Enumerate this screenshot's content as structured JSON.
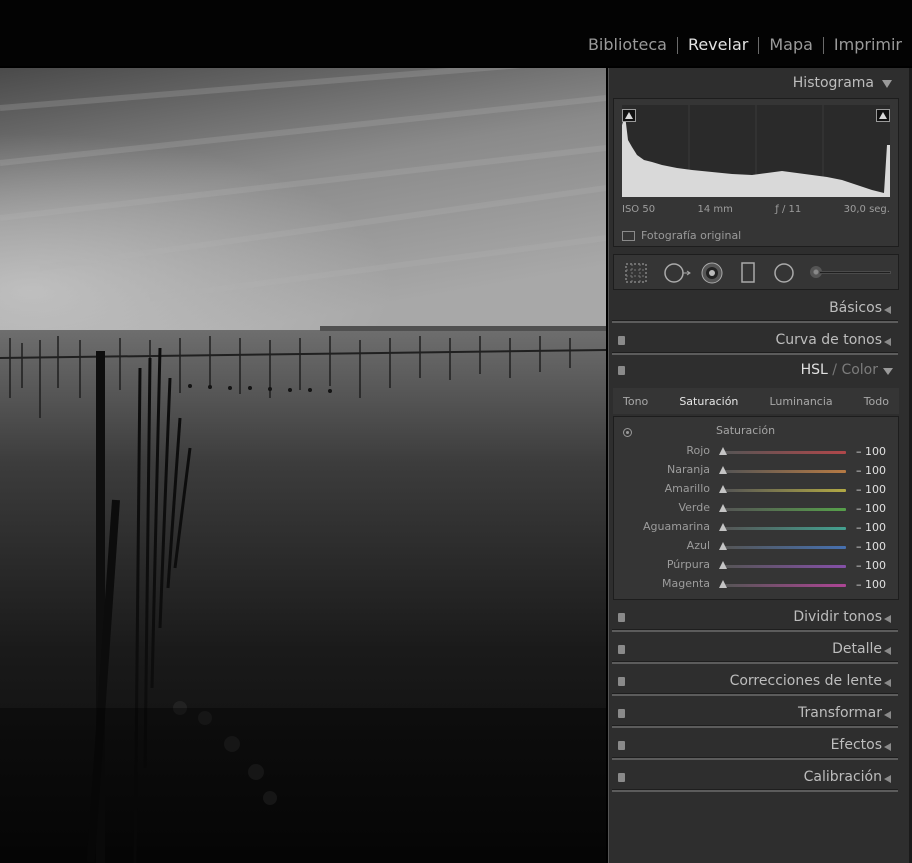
{
  "modules": [
    {
      "label": "Biblioteca",
      "active": false
    },
    {
      "label": "Revelar",
      "active": true
    },
    {
      "label": "Mapa",
      "active": false
    },
    {
      "label": "Imprimir",
      "active": false
    }
  ],
  "histogram": {
    "title": "Histograma",
    "iso": "ISO 50",
    "focal": "14 mm",
    "aperture": "ƒ / 11",
    "shutter": "30,0 seg.",
    "original_label": "Fotografía original"
  },
  "tools": [
    "crop-overlay-icon",
    "spot-removal-icon",
    "red-eye-icon",
    "graduated-filter-icon",
    "radial-filter-icon",
    "adjustment-brush-icon"
  ],
  "sections": {
    "basics": "Básicos",
    "tone_curve": "Curva de tonos",
    "hsl": "HSL",
    "hsl_sep": " / ",
    "color": "Color",
    "split_toning": "Dividir tonos",
    "detail": "Detalle",
    "lens": "Correcciones de lente",
    "transform": "Transformar",
    "effects": "Efectos",
    "calibration": "Calibración"
  },
  "hsl": {
    "tabs": [
      "Tono",
      "Saturación",
      "Luminancia",
      "Todo"
    ],
    "active_tab": 1,
    "group_label": "Saturación",
    "sliders": [
      {
        "name": "Rojo",
        "value": "– 100",
        "color": "#b0474a"
      },
      {
        "name": "Naranja",
        "value": "– 100",
        "color": "#b67a44"
      },
      {
        "name": "Amarillo",
        "value": "– 100",
        "color": "#b2a944"
      },
      {
        "name": "Verde",
        "value": "– 100",
        "color": "#56a04a"
      },
      {
        "name": "Aguamarina",
        "value": "– 100",
        "color": "#43a190"
      },
      {
        "name": "Azul",
        "value": "– 100",
        "color": "#4670b0"
      },
      {
        "name": "Púrpura",
        "value": "– 100",
        "color": "#8550a8"
      },
      {
        "name": "Magenta",
        "value": "– 100",
        "color": "#ad4595"
      }
    ]
  }
}
